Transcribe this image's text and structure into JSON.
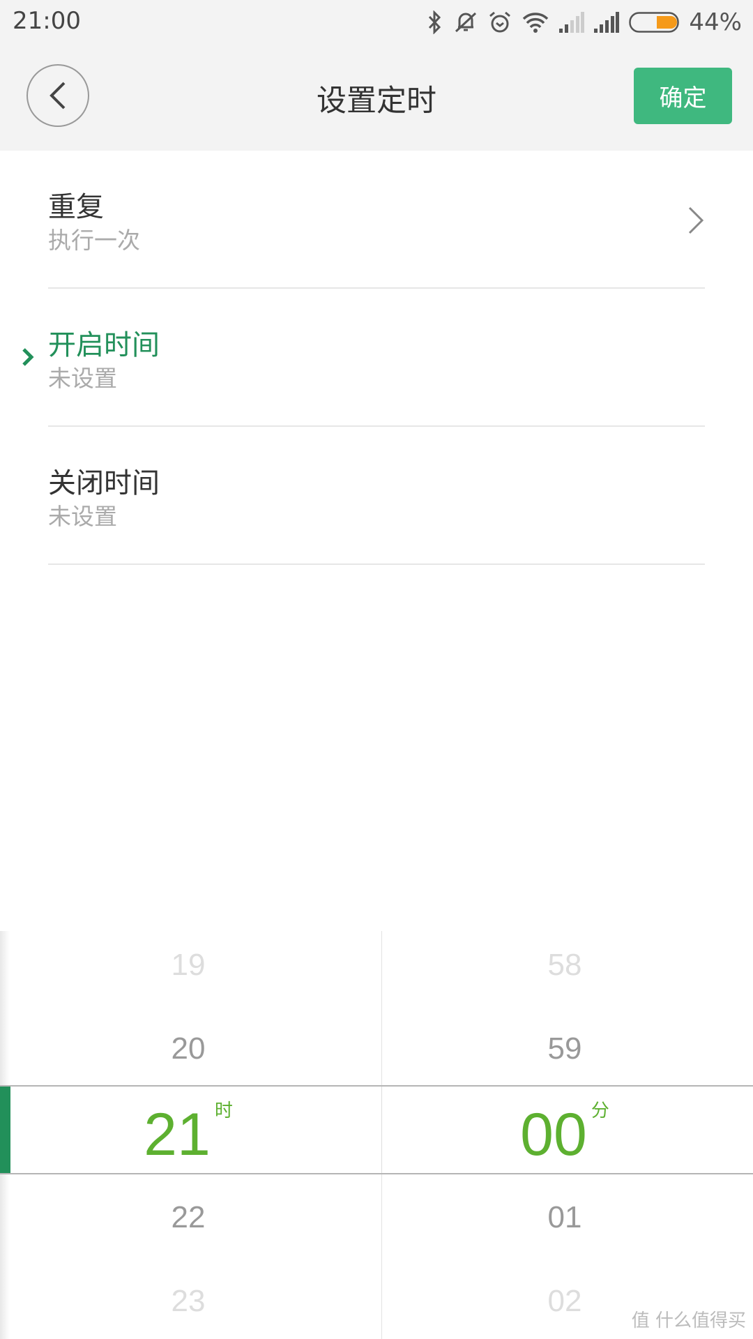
{
  "status": {
    "time": "21:00",
    "battery": "44%",
    "battery_level": 44,
    "icons": [
      "bluetooth-icon",
      "mute-icon",
      "alarm-icon",
      "wifi-icon",
      "signal-icon",
      "signal-icon"
    ]
  },
  "header": {
    "title": "设置定时",
    "confirm": "确定",
    "back_icon": "chevron-left-icon"
  },
  "rows": [
    {
      "title": "重复",
      "value": "执行一次"
    },
    {
      "title": "开启时间",
      "value": "未设置"
    },
    {
      "title": "关闭时间",
      "value": "未设置"
    }
  ],
  "picker": {
    "hours": [
      "19",
      "20",
      "22",
      "23"
    ],
    "hour_selected": "21",
    "hour_unit": "时",
    "minutes": [
      "58",
      "59",
      "01",
      "02"
    ],
    "minute_selected": "00",
    "minute_unit": "分"
  },
  "colors": {
    "accent": "#3fb87f",
    "active_text": "#22905a",
    "picker_selected": "#5db030"
  },
  "watermark": "值 什么值得买"
}
